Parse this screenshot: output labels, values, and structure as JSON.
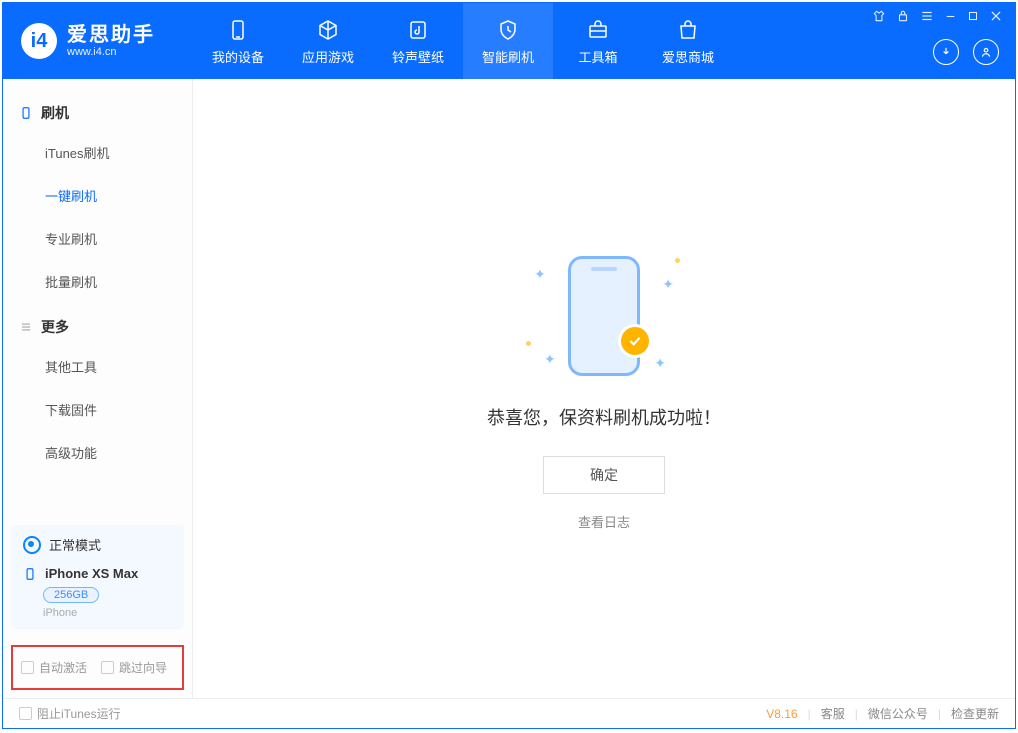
{
  "brand": {
    "title": "爱思助手",
    "url": "www.i4.cn"
  },
  "header_tabs": [
    {
      "label": "我的设备",
      "icon": "device"
    },
    {
      "label": "应用游戏",
      "icon": "box"
    },
    {
      "label": "铃声壁纸",
      "icon": "note"
    },
    {
      "label": "智能刷机",
      "icon": "shield",
      "active": true
    },
    {
      "label": "工具箱",
      "icon": "toolbox"
    },
    {
      "label": "爱思商城",
      "icon": "bag"
    }
  ],
  "sidebar": {
    "group1": {
      "title": "刷机",
      "items": [
        {
          "label": "iTunes刷机"
        },
        {
          "label": "一键刷机",
          "active": true
        },
        {
          "label": "专业刷机"
        },
        {
          "label": "批量刷机"
        }
      ]
    },
    "group2": {
      "title": "更多",
      "items": [
        {
          "label": "其他工具"
        },
        {
          "label": "下载固件"
        },
        {
          "label": "高级功能"
        }
      ]
    }
  },
  "device": {
    "mode_label": "正常模式",
    "name": "iPhone XS Max",
    "storage": "256GB",
    "subtitle": "iPhone"
  },
  "redbox": {
    "auto_activate": "自动激活",
    "skip_guide": "跳过向导"
  },
  "main": {
    "success_text": "恭喜您，保资料刷机成功啦！",
    "ok_button": "确定",
    "log_link": "查看日志"
  },
  "footer": {
    "block_itunes": "阻止iTunes运行",
    "version": "V8.16",
    "link_support": "客服",
    "link_wechat": "微信公众号",
    "link_update": "检查更新"
  }
}
